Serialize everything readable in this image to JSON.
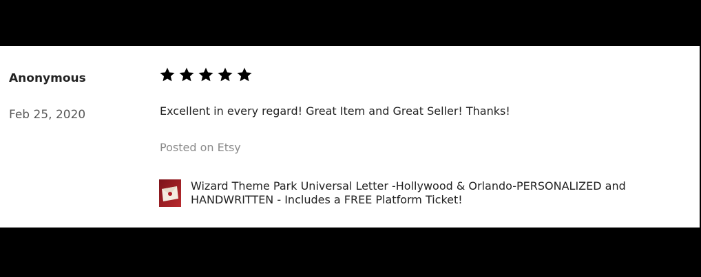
{
  "review": {
    "reviewer_name": "Anonymous",
    "date": "Feb 25, 2020",
    "rating": 5,
    "rating_max": 5,
    "text": "Excellent in every regard! Great Item and Great Seller! Thanks!",
    "source": "Posted on Etsy",
    "item": {
      "thumbnail_icon": "product-thumbnail-icon",
      "title": "Wizard Theme Park Universal Letter -Hollywood & Orlando-PERSONALIZED and HANDWRITTEN - Includes a FREE Platform Ticket!"
    }
  },
  "colors": {
    "background_frame": "#000000",
    "panel": "#ffffff",
    "text_primary": "#222222",
    "text_secondary": "#595959",
    "text_muted": "#8a8a8a",
    "star": "#000000",
    "thumbnail_red": "#9e1b22"
  }
}
